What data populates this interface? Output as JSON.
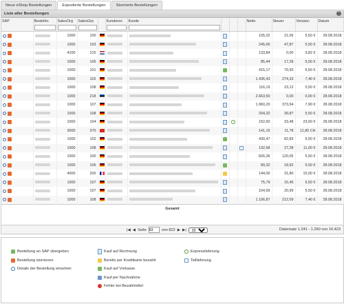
{
  "tabs": [
    "Neue eShop Bestellungen",
    "Exportierte Bestellungen",
    "Stornierte Bestellungen"
  ],
  "panel_title": "Liste aller Bestellungen",
  "columns": {
    "sap": "SAP",
    "bestellnr": "Bestellnr.",
    "salesorg": "SalesOrg",
    "salesgrp": "SalesGrp",
    "kundennr": "Kundennr.",
    "kunde": "Kunde",
    "netto": "Netto",
    "steuer": "Steuer",
    "versand": "Versanc",
    "datum": "Datum"
  },
  "rows": [
    {
      "salesorg": "1000",
      "salesgrp": "100",
      "flag": "de",
      "netto": "105,32",
      "steuer": "21,06",
      "versand": "5,50 €",
      "datum": "28.08.2018",
      "doc": "doc"
    },
    {
      "salesorg": "1000",
      "salesgrp": "103",
      "flag": "de",
      "netto": "245,65",
      "steuer": "47,87",
      "versand": "5,50 €",
      "datum": "28.08.2018",
      "doc": "doc"
    },
    {
      "salesorg": "4100",
      "salesgrp": "215",
      "flag": "nl",
      "netto": "133,84",
      "steuer": "0,00",
      "versand": "9,82 €",
      "datum": "28.08.2018",
      "doc": "doc"
    },
    {
      "salesorg": "1000",
      "salesgrp": "105",
      "flag": "de",
      "netto": "85,44",
      "steuer": "17,28",
      "versand": "5,50 €",
      "datum": "28.08.2018",
      "doc": "doc"
    },
    {
      "salesorg": "1000",
      "salesgrp": "101",
      "flag": "de",
      "netto": "415,17",
      "steuer": "79,93",
      "versand": "5,50 €",
      "datum": "28.08.2018",
      "doc": "cash"
    },
    {
      "salesorg": "1000",
      "salesgrp": "102",
      "flag": "de",
      "netto": "1.436,43",
      "steuer": "274,33",
      "versand": "7,40 €",
      "datum": "28.08.2018",
      "doc": "doc"
    },
    {
      "salesorg": "1000",
      "salesgrp": "108",
      "flag": "de",
      "netto": "116,19",
      "steuer": "23,12",
      "versand": "5,50 €",
      "datum": "28.08.2018",
      "doc": "doc"
    },
    {
      "salesorg": "1000",
      "salesgrp": "218",
      "flag": "ee",
      "netto": "2.663,50",
      "steuer": "0,00",
      "versand": "0,00 €",
      "datum": "28.08.2018",
      "doc": "doc"
    },
    {
      "salesorg": "1000",
      "salesgrp": "107",
      "flag": "de",
      "netto": "1.960,20",
      "steuer": "373,94",
      "versand": "7,90 €",
      "datum": "28.08.2018",
      "doc": "doc"
    },
    {
      "salesorg": "1000",
      "salesgrp": "108",
      "flag": "de",
      "netto": "204,32",
      "steuer": "39,87",
      "versand": "5,50 €",
      "datum": "28.08.2018",
      "doc": "doc"
    },
    {
      "salesorg": "1000",
      "salesgrp": "104",
      "flag": "de",
      "netto": "152,60",
      "steuer": "33,48",
      "versand": "23,60 €",
      "datum": "28.08.2018",
      "doc": "doc"
    },
    {
      "salesorg": "3000",
      "salesgrp": "370",
      "flag": "ch",
      "netto": "141,15",
      "steuer": "11,78",
      "versand": "11,80 CH",
      "datum": "28.08.2018",
      "doc": "doc"
    },
    {
      "salesorg": "1000",
      "salesgrp": "102",
      "flag": "de",
      "netto": "430,47",
      "steuer": "82,83",
      "versand": "5,50 €",
      "datum": "28.08.2018",
      "doc": "cash"
    },
    {
      "salesorg": "1000",
      "salesgrp": "108",
      "flag": "de",
      "netto": "132,58",
      "steuer": "27,28",
      "versand": "11,00 €",
      "datum": "28.08.2018",
      "doc": "doc"
    },
    {
      "salesorg": "1000",
      "salesgrp": "100",
      "flag": "de",
      "netto": "826,36",
      "steuer": "120,05",
      "versand": "5,50 €",
      "datum": "28.08.2018",
      "doc": "doc"
    },
    {
      "salesorg": "1000",
      "salesgrp": "106",
      "flag": "de",
      "netto": "89,32",
      "steuer": "18,92",
      "versand": "5,50 €",
      "datum": "28.08.2018",
      "doc": "cash"
    },
    {
      "salesorg": "4000",
      "salesgrp": "200",
      "flag": "fr",
      "netto": "144,00",
      "steuer": "31,80",
      "versand": "15,00 €",
      "datum": "28.08.2018",
      "doc": "card"
    },
    {
      "salesorg": "1000",
      "salesgrp": "107",
      "flag": "de",
      "netto": "75,79",
      "steuer": "15,45",
      "versand": "5,50 €",
      "datum": "28.08.2018",
      "doc": "doc"
    },
    {
      "salesorg": "1000",
      "salesgrp": "107",
      "flag": "de",
      "netto": "104,99",
      "steuer": "20,99",
      "versand": "5,50 €",
      "datum": "28.08.2018",
      "doc": "doc"
    },
    {
      "salesorg": "1000",
      "salesgrp": "108",
      "flag": "de",
      "netto": "1.106,87",
      "steuer": "212,09",
      "versand": "7,40 €",
      "datum": "28.08.2018",
      "doc": "doc"
    }
  ],
  "total_label": "Gesamt",
  "pager": {
    "seite": "Seite",
    "page": "63",
    "von": "von 822",
    "per_page": "20",
    "summary": "Datensatz 1.241 - 1.260 von 16.423"
  },
  "legend": {
    "col1": [
      "Bestellung an SAP übergeben",
      "Bestellung stornieren",
      "Details der Bestellung einsehen"
    ],
    "col2": [
      "Kauf auf Rechnung",
      "Bereits per Kreditkarte bezahlt",
      "Kauf auf Vorkasse",
      "Kauf per Nachnahme",
      "Fehler bei Bezahlmittel"
    ],
    "col3": [
      "Expresslieferung",
      "Teillieferung"
    ]
  }
}
